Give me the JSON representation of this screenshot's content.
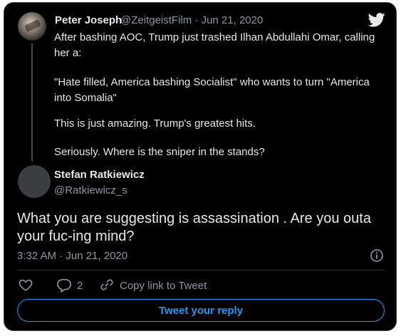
{
  "original_tweet": {
    "author_name": "Peter Joseph",
    "handle_date": "@ZeitgeistFilm · Jun 21, 2020",
    "lines": [
      "After bashing AOC, Trump just trashed Ilhan Abdullahi Omar, calling",
      "her a:",
      "\"Hate filled, America bashing Socialist\"  who wants to turn \"America",
      "into Somalia\"",
      "This is just amazing. Trump's greatest hits.",
      "Seriously. Where is the sniper in the stands?"
    ]
  },
  "reply": {
    "author_name": "Stefan Ratkiewicz",
    "handle": "@Ratkiewicz_s",
    "text_lines": [
      "What you are suggesting is assassination . Are you outa",
      "your fuc-ing mind?"
    ],
    "timestamp": "3:32 AM · Jun 21, 2020"
  },
  "actions": {
    "reply_count": "2",
    "copy_link_label": "Copy link to Tweet"
  },
  "reply_button_label": "Tweet your reply",
  "icons": {
    "logo": "twitter-bird-icon",
    "info": "info-icon",
    "like": "heart-icon",
    "reply": "comment-icon",
    "copy": "link-icon"
  },
  "colors": {
    "background": "#000000",
    "text": "#e7e9ea",
    "secondary_text": "#8b98a5",
    "accent": "#1d9bf0"
  }
}
